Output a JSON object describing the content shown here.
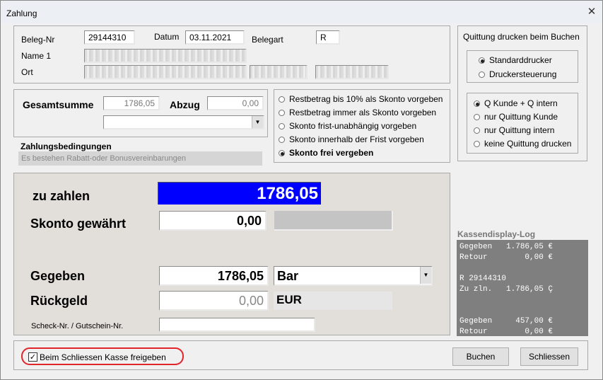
{
  "window": {
    "title": "Zahlung",
    "close_glyph": "✕"
  },
  "beleg": {
    "nr_label": "Beleg-Nr",
    "nr_value": "29144310",
    "datum_label": "Datum",
    "datum_value": "03.11.2021",
    "belegart_label": "Belegart",
    "belegart_value": "R",
    "name_label": "Name 1",
    "ort_label": "Ort"
  },
  "summen": {
    "gesamt_label": "Gesamtsumme",
    "gesamt_value": "1786,05",
    "abzug_label": "Abzug",
    "abzug_value": "0,00"
  },
  "zahlungsbedingungen": {
    "label": "Zahlungsbedingungen",
    "text": "Es bestehen Rabatt-oder Bonusvereinbarungen"
  },
  "skonto_options": [
    {
      "label": "Restbetrag bis 10% als Skonto vorgeben",
      "selected": false
    },
    {
      "label": "Restbetrag immer als Skonto vorgeben",
      "selected": false
    },
    {
      "label": "Skonto frist-unabhängig vorgeben",
      "selected": false
    },
    {
      "label": "Skonto innerhalb der Frist vorgeben",
      "selected": false
    },
    {
      "label": "Skonto frei vergeben",
      "selected": true
    }
  ],
  "quittung": {
    "title": "Quittung drucken beim Buchen",
    "drucker": [
      {
        "label": "Standarddrucker",
        "selected": true
      },
      {
        "label": "Druckersteuerung",
        "selected": false
      }
    ],
    "typ": [
      {
        "label": "Q Kunde + Q intern",
        "selected": true
      },
      {
        "label": "nur Quittung Kunde",
        "selected": false
      },
      {
        "label": "nur Quittung intern",
        "selected": false
      },
      {
        "label": "keine Quittung drucken",
        "selected": false
      }
    ]
  },
  "zahlung": {
    "zu_zahlen_label": "zu zahlen",
    "zu_zahlen_value": "1786,05",
    "skonto_label": "Skonto gewährt",
    "skonto_value": "0,00",
    "gegeben_label": "Gegeben",
    "gegeben_value": "1786,05",
    "zahlart_value": "Bar",
    "rueckgeld_label": "Rückgeld",
    "rueckgeld_value": "0,00",
    "waehrung_value": "EUR",
    "scheck_label": "Scheck-Nr. / Gutschein-Nr."
  },
  "kassendisplay": {
    "label": "Kassendisplay-Log",
    "lines": [
      "Gegeben   1.786,05 €",
      "Retour        0,00 €",
      "",
      "R 29144310",
      "Zu zln.   1.786,05 Ç",
      "",
      "",
      "Gegeben     457,00 €",
      "Retour        0,00 €"
    ]
  },
  "footer": {
    "kasse_label": "Beim Schliessen Kasse freigeben",
    "kasse_checked": true,
    "buchen_label": "Buchen",
    "schliessen_label": "Schliessen"
  },
  "colors": {
    "accent_blue": "#0000ff",
    "highlight_red": "#e0262b",
    "log_bg": "#7f7f7f"
  },
  "icons": {
    "dropdown": "▼",
    "check": "✓"
  }
}
